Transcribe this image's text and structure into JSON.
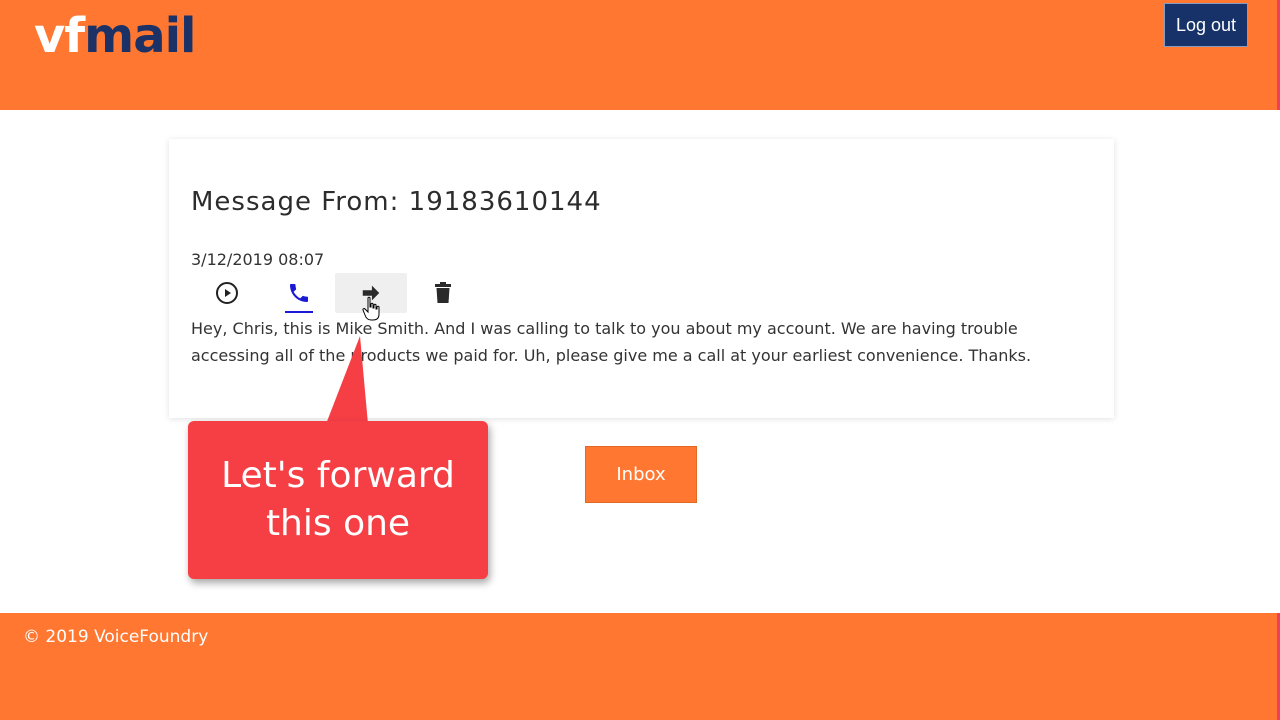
{
  "header": {
    "logo_part1": "vf",
    "logo_part2": "mail",
    "logout_label": "Log out",
    "background_color": "#ff7730",
    "logo_accent_color": "#1c3266"
  },
  "message": {
    "title": "Message From: 19183610144",
    "date": "3/12/2019 08:07",
    "actions": [
      {
        "name": "play",
        "icon": "play-circle-icon"
      },
      {
        "name": "call",
        "icon": "phone-icon"
      },
      {
        "name": "forward",
        "icon": "arrow-right-icon"
      },
      {
        "name": "delete",
        "icon": "trash-icon"
      }
    ],
    "transcript": "Hey, Chris, this is Mike Smith. And I was calling to talk to you about my account. We are having trouble accessing all of the products we paid for. Uh, please give me a call at your earliest convenience. Thanks."
  },
  "inbox_label": "Inbox",
  "callout": {
    "line1": "Let's forward",
    "line2": "this one",
    "color": "#f53f45"
  },
  "footer": {
    "copyright": "© 2019 VoiceFoundry"
  }
}
